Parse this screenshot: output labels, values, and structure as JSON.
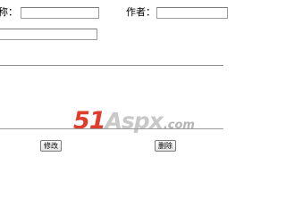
{
  "form": {
    "name_label": "称：",
    "name_value": "",
    "author_label": "作者：",
    "author_value": "",
    "second_value": ""
  },
  "buttons": {
    "edit_label": "修改",
    "delete_label": "删除"
  },
  "watermark": {
    "prefix": "51",
    "main": "Aspx",
    "suffix": ".com",
    "prefix_color": "#e03c2c",
    "main_color": "#c8c8c8"
  }
}
